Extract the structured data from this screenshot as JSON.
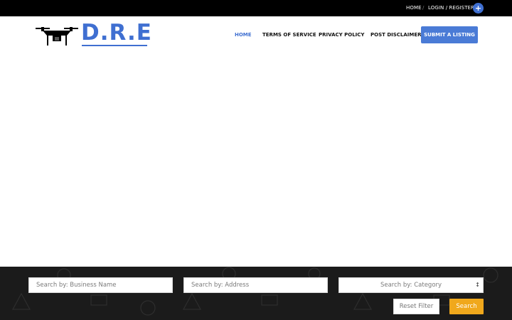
{
  "topbar": {
    "home_label": "HOME",
    "separator": "/",
    "login_label": "LOGIN / REGISTER",
    "plus_glyph": "+"
  },
  "header": {
    "logo_text": "D.R.E",
    "nav": [
      {
        "label": "HOME",
        "active": true
      },
      {
        "label": "TERMS OF SERVICE",
        "active": false
      },
      {
        "label": "PRIVACY POLICY",
        "active": false
      },
      {
        "label": "POST DISCLAIMER",
        "active": false
      }
    ],
    "cta_label": "SUBMIT A LISTING"
  },
  "search": {
    "business_placeholder": "Search by: Business Name",
    "address_placeholder": "Search by: Address",
    "category_placeholder": "Search by: Category",
    "reset_label": "Reset Filter",
    "search_label": "Search"
  },
  "colors": {
    "accent": "#3f6fd1",
    "cta": "#4a7bd6",
    "search_button": "#f0a81c",
    "topbar": "#000000",
    "band": "#1b1b1b"
  },
  "icons": {
    "logo": "drone-icon",
    "plus": "plus-icon",
    "select_caret": "updown-caret-icon"
  }
}
